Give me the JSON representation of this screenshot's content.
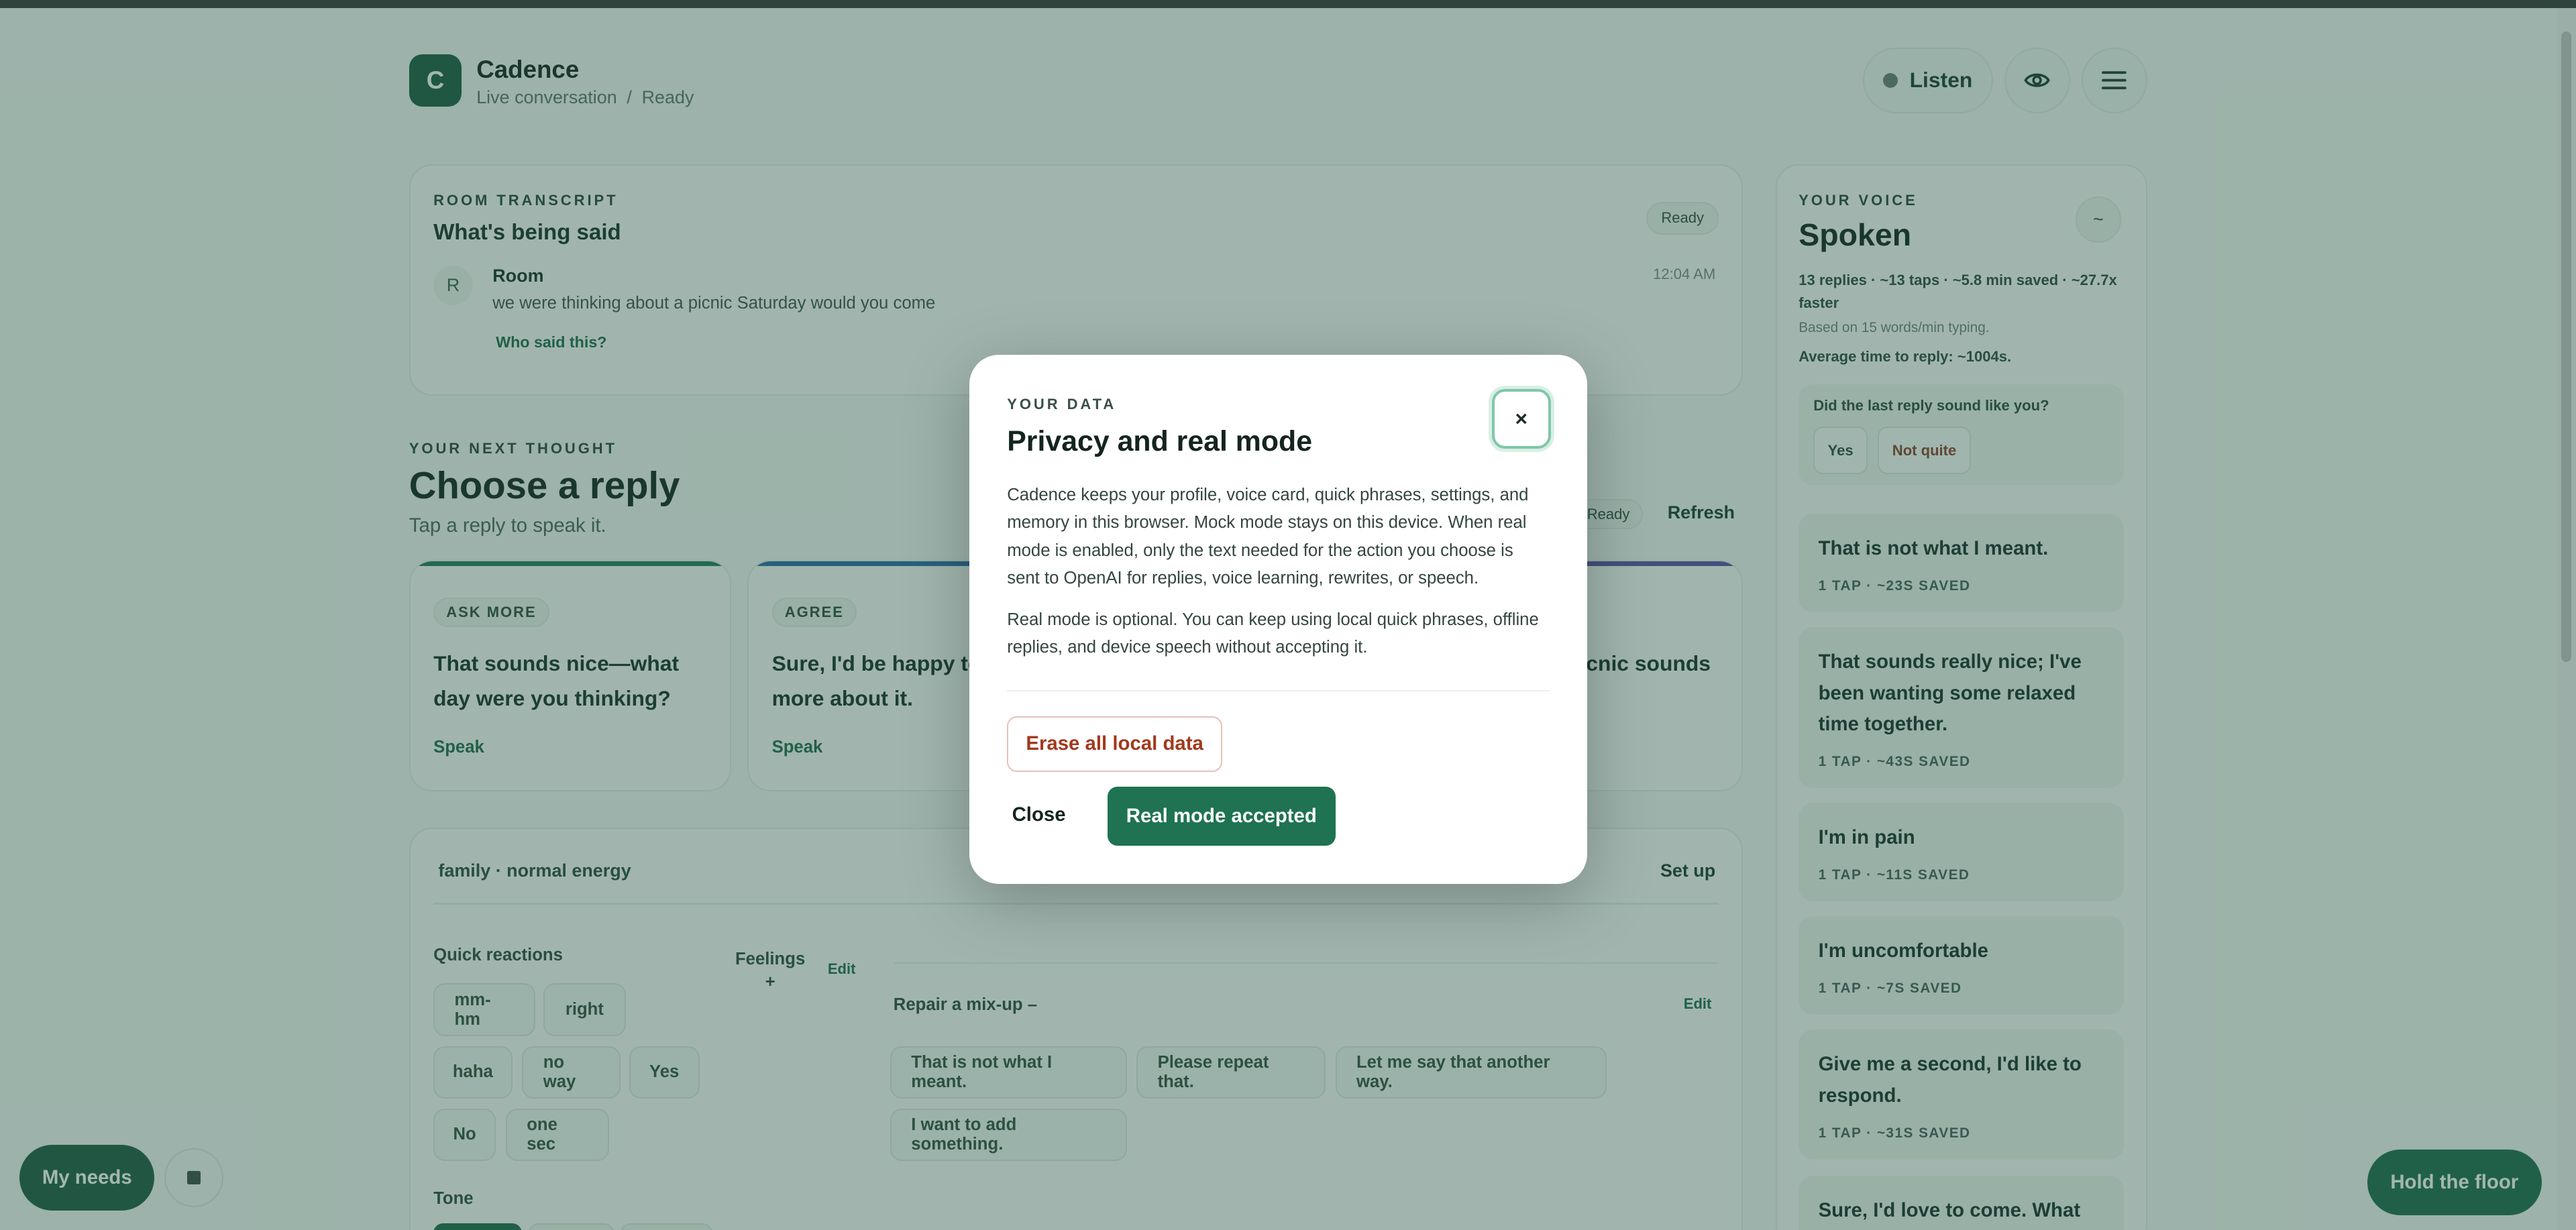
{
  "app": {
    "logo_letter": "C",
    "name": "Cadence",
    "breadcrumb": [
      "Live conversation",
      "/",
      "Ready"
    ]
  },
  "header": {
    "listen_label": "Listen",
    "eye_icon": "eye-icon",
    "menu_icon": "hamburger-menu-icon"
  },
  "transcript": {
    "eyebrow": "ROOM TRANSCRIPT",
    "title": "What's being said",
    "status": "Ready",
    "entries": [
      {
        "avatar": "R",
        "speaker": "Room",
        "text": "we were thinking about a picnic Saturday would you come",
        "time": "12:04 AM"
      }
    ],
    "who_said": "Who said this?"
  },
  "next_thought": {
    "eyebrow": "YOUR NEXT THOUGHT",
    "title": "Choose a reply",
    "subtitle": "Tap a reply to speak it.",
    "status": "Ready",
    "refresh_label": "Refresh",
    "replies": [
      {
        "tag": "ASK MORE",
        "text": "That sounds nice—what day were you thinking?",
        "action": "Speak",
        "accent": "#1f7a5a"
      },
      {
        "tag": "AGREE",
        "text": "Sure, I'd be happy to hear more about it.",
        "action": "Speak",
        "accent": "#2c6aa8"
      },
      {
        "tag": "",
        "text": "icnic sounds",
        "action": "",
        "accent": "#5b4fa8"
      }
    ]
  },
  "phrases": {
    "context": "family · normal energy",
    "setup_label": "Set up",
    "quick_reactions_label": "Quick reactions",
    "quick_reactions": [
      "mm-hm",
      "right",
      "haha",
      "no way",
      "Yes",
      "No",
      "one sec"
    ],
    "feelings_label": "Feelings",
    "feelings_toggle": "+",
    "edit_label": "Edit",
    "repair_label": "Repair a mix-up –",
    "repair_edit_label": "Edit",
    "repair_phrases": [
      "That is not what I meant.",
      "Please repeat that.",
      "Let me say that another way.",
      "I want to add something."
    ],
    "tone_label": "Tone"
  },
  "voice": {
    "eyebrow": "YOUR VOICE",
    "title": "Spoken",
    "toggle": "~",
    "stats": "13 replies · ~13 taps · ~5.8 min saved · ~27.7x faster",
    "basis": "Based on 15 words/min typing.",
    "average": "Average time to reply: ~1004s.",
    "feedback_question": "Did the last reply sound like you?",
    "feedback_yes": "Yes",
    "feedback_no": "Not quite",
    "history": [
      {
        "text": "That is not what I meant.",
        "meta": "1 TAP · ~23S SAVED"
      },
      {
        "text": "That sounds really nice; I've been wanting some relaxed time together.",
        "meta": "1 TAP · ~43S SAVED"
      },
      {
        "text": "I'm in pain",
        "meta": "1 TAP · ~11S SAVED"
      },
      {
        "text": "I'm uncomfortable",
        "meta": "1 TAP · ~7S SAVED"
      },
      {
        "text": "Give me a second, I'd like to respond.",
        "meta": "1 TAP · ~31S SAVED"
      },
      {
        "text": "Sure, I'd love to come. What",
        "meta": ""
      }
    ]
  },
  "floating": {
    "my_needs_label": "My needs",
    "stop_icon": "stop-icon",
    "hold_floor_label": "Hold the floor"
  },
  "modal": {
    "eyebrow": "YOUR DATA",
    "title": "Privacy and real mode",
    "close_icon_glyph": "×",
    "paragraph1": "Cadence keeps your profile, voice card, quick phrases, settings, and memory in this browser. Mock mode stays on this device. When real mode is enabled, only the text needed for the action you choose is sent to OpenAI for replies, voice learning, rewrites, or speech.",
    "paragraph2": "Real mode is optional. You can keep using local quick phrases, offline replies, and device speech without accepting it.",
    "erase_label": "Erase all local data",
    "close_label": "Close",
    "accept_label": "Real mode accepted"
  }
}
